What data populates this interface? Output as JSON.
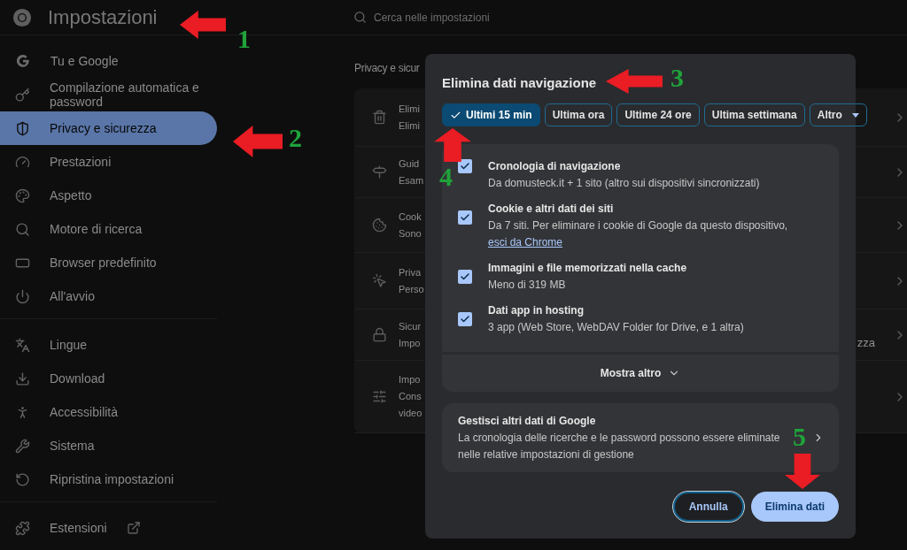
{
  "header": {
    "title": "Impostazioni"
  },
  "search": {
    "placeholder": "Cerca nelle impostazioni"
  },
  "sidebar": {
    "sections": [
      {
        "items": [
          {
            "label": "Tu e Google",
            "selected": false
          },
          {
            "label": "Compilazione automatica e password",
            "selected": false
          },
          {
            "label": "Privacy e sicurezza",
            "selected": true
          },
          {
            "label": "Prestazioni",
            "selected": false
          },
          {
            "label": "Aspetto",
            "selected": false
          },
          {
            "label": "Motore di ricerca",
            "selected": false
          },
          {
            "label": "Browser predefinito",
            "selected": false
          },
          {
            "label": "All'avvio",
            "selected": false
          }
        ]
      },
      {
        "items": [
          {
            "label": "Lingue",
            "selected": false
          },
          {
            "label": "Download",
            "selected": false
          },
          {
            "label": "Accessibilità",
            "selected": false
          },
          {
            "label": "Sistema",
            "selected": false
          },
          {
            "label": "Ripristina impostazioni",
            "selected": false
          }
        ]
      },
      {
        "items": [
          {
            "label": "Estensioni",
            "selected": false
          }
        ]
      }
    ]
  },
  "main": {
    "heading": "Privacy e sicur",
    "rows": [
      {
        "lines": [
          "Elimi",
          "Elimi"
        ]
      },
      {
        "lines": [
          "Guid",
          "Esam"
        ]
      },
      {
        "lines": [
          "Cook",
          "Sono"
        ]
      },
      {
        "lines": [
          "Priva",
          "Perso"
        ]
      },
      {
        "lines": [
          "Sicur",
          "Impo"
        ],
        "tail": "zza"
      },
      {
        "lines": [
          "Impo",
          "Cons",
          "video"
        ]
      }
    ]
  },
  "dialog": {
    "title": "Elimina dati navigazione",
    "ranges": [
      {
        "label": "Ultimi 15 min",
        "selected": true,
        "kind": "chip"
      },
      {
        "label": "Ultima ora",
        "selected": false,
        "kind": "chip"
      },
      {
        "label": "Ultime 24 ore",
        "selected": false,
        "kind": "chip"
      },
      {
        "label": "Ultima settimana",
        "selected": false,
        "kind": "chip"
      },
      {
        "label": "Altro",
        "selected": false,
        "kind": "dropdown"
      }
    ],
    "items": [
      {
        "title": "Cronologia di navigazione",
        "description": "Da domusteck.it + 1 sito (altro sui dispositivi sincronizzati)",
        "checked": true
      },
      {
        "title": "Cookie e altri dati dei siti",
        "description": "Da 7 siti. Per eliminare i cookie di Google da questo dispositivo,",
        "link": "esci da Chrome",
        "checked": true
      },
      {
        "title": "Immagini e file memorizzati nella cache",
        "description": "Meno di 319 MB",
        "checked": true
      },
      {
        "title": "Dati app in hosting",
        "description": "3 app (Web Store, WebDAV Folder for Drive, e 1 altra)",
        "checked": true
      }
    ],
    "show_more": "Mostra altro",
    "manage": {
      "title": "Gestisci altri dati di Google",
      "description": "La cronologia delle ricerche e le password possono essere eliminate nelle relative impostazioni di gestione"
    },
    "buttons": [
      {
        "label": "Annulla",
        "kind": "secondary"
      },
      {
        "label": "Elimina dati",
        "kind": "primary"
      }
    ]
  },
  "annotations": [
    {
      "label": "1",
      "kind": "left"
    },
    {
      "label": "2",
      "kind": "left"
    },
    {
      "label": "3",
      "kind": "left"
    },
    {
      "label": "4",
      "kind": "up"
    },
    {
      "label": "5",
      "kind": "down"
    }
  ]
}
